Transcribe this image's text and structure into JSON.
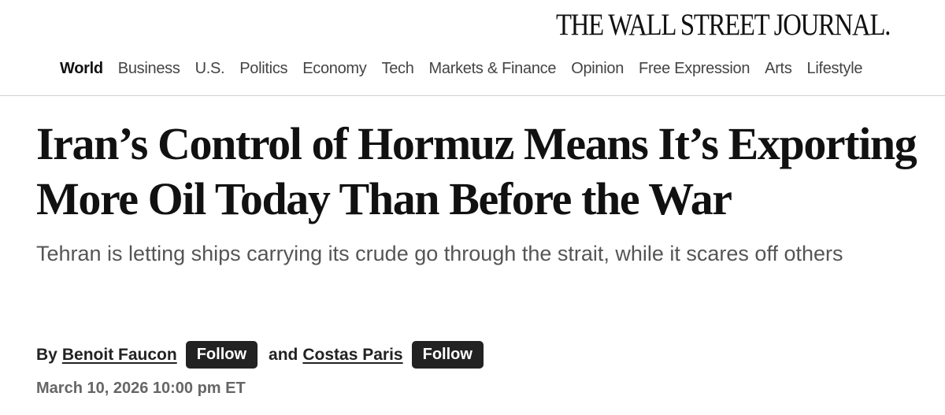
{
  "masthead": {
    "logo_text": "THE WALL STREET JOURNAL."
  },
  "nav": {
    "items": [
      {
        "label": "World",
        "active": true
      },
      {
        "label": "Business",
        "active": false
      },
      {
        "label": "U.S.",
        "active": false
      },
      {
        "label": "Politics",
        "active": false
      },
      {
        "label": "Economy",
        "active": false
      },
      {
        "label": "Tech",
        "active": false
      },
      {
        "label": "Markets & Finance",
        "active": false
      },
      {
        "label": "Opinion",
        "active": false
      },
      {
        "label": "Free Expression",
        "active": false
      },
      {
        "label": "Arts",
        "active": false
      },
      {
        "label": "Lifestyle",
        "active": false
      }
    ]
  },
  "article": {
    "headline": "Iran’s Control of Hormuz Means It’s Exporting More Oil Today Than Before the War",
    "dek": "Tehran is letting ships carrying its crude go through the strait, while it scares off others",
    "byline": {
      "prefix": "By",
      "author1": "Benoit Faucon",
      "follow_label": "Follow",
      "conjunction": "and",
      "author2": "Costas Paris"
    },
    "timestamp": "March 10, 2026 10:00 pm ET"
  }
}
